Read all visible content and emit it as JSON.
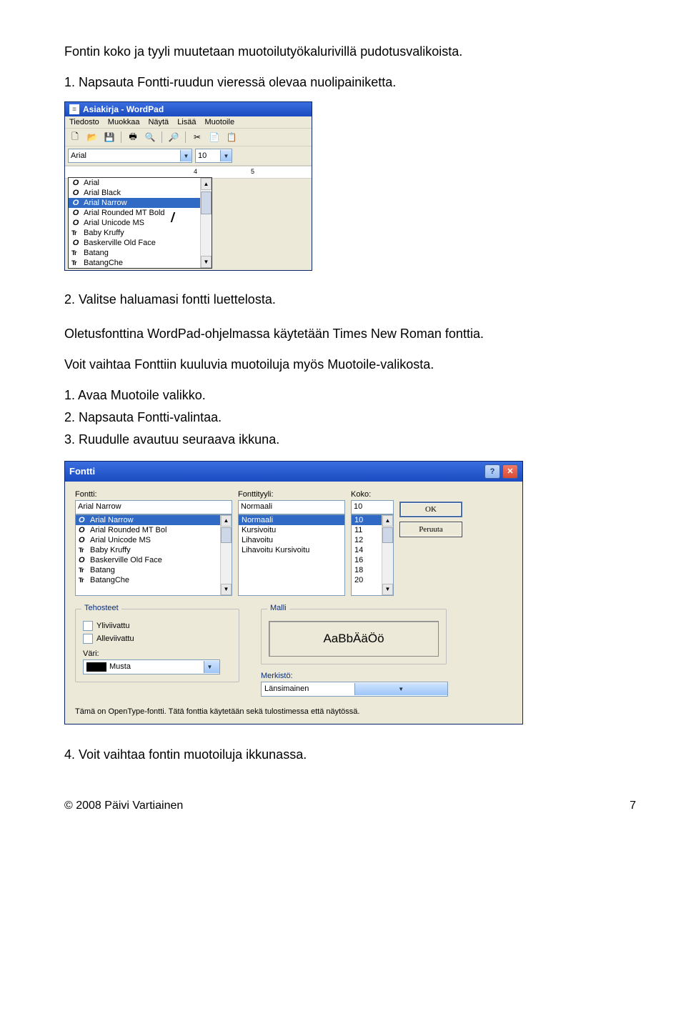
{
  "doc": {
    "intro": "Fontin koko ja tyyli muutetaan muotoilutyökalurivillä pudotusvalikoista.",
    "step1": "1. Napsauta Fontti-ruudun vieressä olevaa nuolipainiketta.",
    "step2": "2. Valitse haluamasi fontti luettelosta.",
    "default_note": "Oletusfonttina WordPad-ohjelmassa käytetään Times New Roman fonttia.",
    "alt_intro": "Voit vaihtaa Fonttiin kuuluvia muotoiluja myös Muotoile-valikosta.",
    "alt1": "1. Avaa Muotoile valikko.",
    "alt2": "2. Napsauta Fontti-valintaa.",
    "alt3": "3. Ruudulle avautuu seuraava ikkuna.",
    "step4": "4. Voit vaihtaa fontin muotoiluja ikkunassa.",
    "footer_left": "© 2008 Päivi Vartiainen",
    "footer_page": "7"
  },
  "wordpad": {
    "title": "Asiakirja - WordPad",
    "title_icon": "≡",
    "menu": [
      "Tiedosto",
      "Muokkaa",
      "Näytä",
      "Lisää",
      "Muotoile"
    ],
    "font_value": "Arial",
    "size_value": "10",
    "ruler_marks": [
      "4",
      "5"
    ],
    "fonts": [
      {
        "icon": "O",
        "name": "Arial"
      },
      {
        "icon": "O",
        "name": "Arial Black"
      },
      {
        "icon": "O",
        "name": "Arial Narrow",
        "selected": true
      },
      {
        "icon": "O",
        "name": "Arial Rounded MT Bold"
      },
      {
        "icon": "O",
        "name": "Arial Unicode MS"
      },
      {
        "icon": "Tr",
        "name": "Baby Kruffy"
      },
      {
        "icon": "O",
        "name": "Baskerville Old Face"
      },
      {
        "icon": "Tr",
        "name": "Batang"
      },
      {
        "icon": "Tr",
        "name": "BatangChe"
      }
    ]
  },
  "dialog": {
    "title": "Fontti",
    "labels": {
      "font": "Fontti:",
      "style": "Fonttityyli:",
      "size": "Koko:",
      "ok": "OK",
      "cancel": "Peruuta",
      "effects": "Tehosteet",
      "strike": "Yliviivattu",
      "underline": "Alleviivattu",
      "color": "Väri:",
      "color_value": "Musta",
      "sample": "Malli",
      "sample_text": "AaBbÄäÖö",
      "charset": "Merkistö:",
      "charset_value": "Länsimainen",
      "note": "Tämä on OpenType-fontti. Tätä fonttia käytetään sekä tulostimessa että näytössä."
    },
    "font_value": "Arial Narrow",
    "style_value": "Normaali",
    "size_value": "10",
    "font_list": [
      {
        "icon": "O",
        "name": "Arial Narrow",
        "selected": true
      },
      {
        "icon": "O",
        "name": "Arial Rounded MT Bol"
      },
      {
        "icon": "O",
        "name": "Arial Unicode MS"
      },
      {
        "icon": "Tr",
        "name": "Baby Kruffy"
      },
      {
        "icon": "O",
        "name": "Baskerville Old Face"
      },
      {
        "icon": "Tr",
        "name": "Batang"
      },
      {
        "icon": "Tr",
        "name": "BatangChe"
      }
    ],
    "style_list": [
      {
        "name": "Normaali",
        "selected": true
      },
      {
        "name": "Kursivoitu"
      },
      {
        "name": "Lihavoitu"
      },
      {
        "name": "Lihavoitu Kursivoitu"
      }
    ],
    "size_list": [
      "10",
      "11",
      "12",
      "14",
      "16",
      "18",
      "20"
    ]
  }
}
